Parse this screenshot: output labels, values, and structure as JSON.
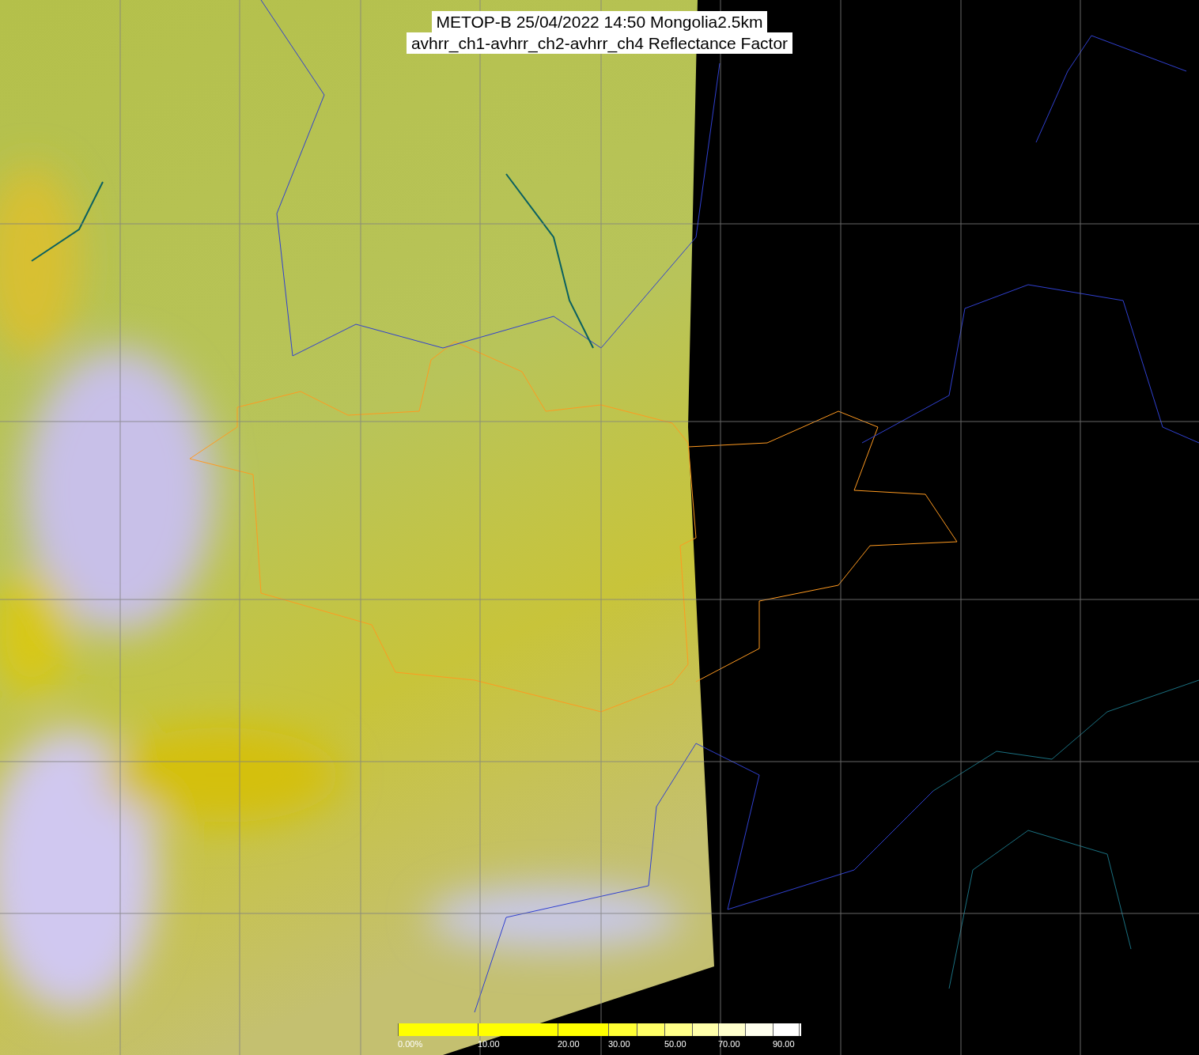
{
  "title": {
    "lines": [
      "METOP-B 25/04/2022 14:50 Mongolia2.5km",
      "avhrr_ch1-avhrr_ch2-avhrr_ch4 Reflectance Factor"
    ]
  },
  "colorbar": {
    "segments": [
      {
        "color": "#ffff00",
        "label": "0.00%"
      },
      {
        "color": "#ffff00",
        "label": "10.00"
      },
      {
        "color": "#ffff00",
        "label": "20.00"
      },
      {
        "color": "#ffff33",
        "label": "30.00"
      },
      {
        "color": "#ffff66"
      },
      {
        "color": "#ffff88",
        "label": "50.00"
      },
      {
        "color": "#ffffaa"
      },
      {
        "color": "#ffffcc",
        "label": "70.00"
      },
      {
        "color": "#ffffee"
      },
      {
        "color": "#ffffff",
        "label": "90.00"
      },
      {
        "color": "#ffffff"
      }
    ]
  }
}
